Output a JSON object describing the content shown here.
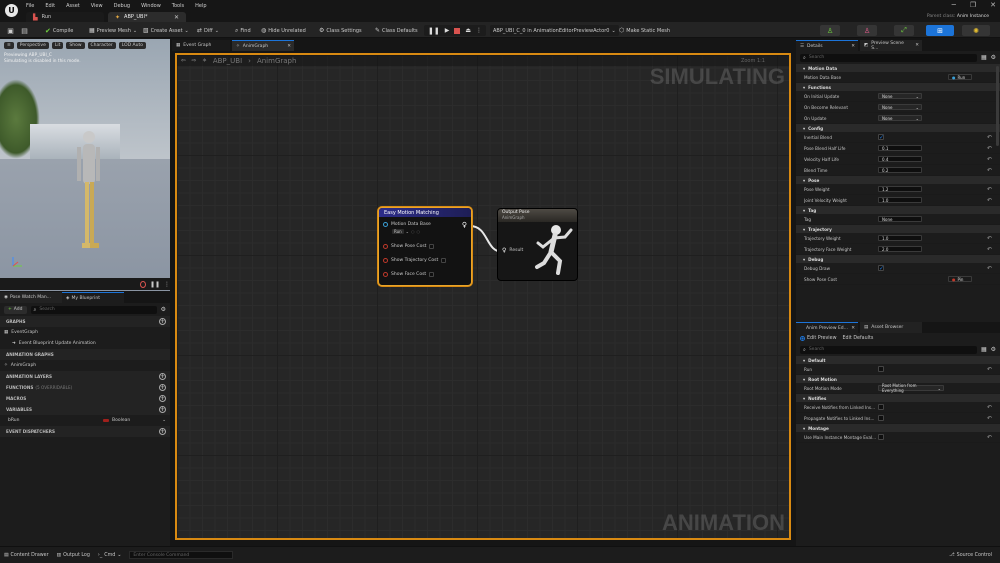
{
  "menu": [
    "File",
    "Edit",
    "Asset",
    "View",
    "Debug",
    "Window",
    "Tools",
    "Help"
  ],
  "tabs": [
    {
      "label": "Run"
    },
    {
      "label": "ABP_UBI*"
    }
  ],
  "parent_class": {
    "label": "Parent class:",
    "value": "Anim Instance"
  },
  "toolbar": {
    "compile": "Compile",
    "preview_mesh": "Preview Mesh",
    "create_asset": "Create Asset",
    "diff": "Diff",
    "find": "Find",
    "hide_unrelated": "Hide Unrelated",
    "class_settings": "Class Settings",
    "class_defaults": "Class Defaults",
    "debug_object": "ABP_UBI_C_0 in AnimationEditorPreviewActor0",
    "make_static_mesh": "Make Static Mesh"
  },
  "viewport": {
    "perspective": "Perspective",
    "lit": "Lit",
    "show": "Show",
    "character": "Character",
    "lod": "LOD Auto",
    "info1": "Previewing ABP_UBI_C",
    "info2": "Simulating is disabled in this mode."
  },
  "left_tabs": [
    "Pose Watch Man...",
    "My Blueprint"
  ],
  "my_blueprint": {
    "add": "Add",
    "search_placeholder": "Search",
    "graphs": "GRAPHS",
    "event_graph": "EventGraph",
    "event_update": "Event Blueprint Update Animation",
    "animation_graphs": "ANIMATION GRAPHS",
    "anim_graph": "AnimGraph",
    "animation_layers": "ANIMATION LAYERS",
    "functions": "FUNCTIONS",
    "functions_count": "(5 OVERRIDABLE)",
    "macros": "MACROS",
    "variables": "VARIABLES",
    "var_name": "bRun",
    "var_type": "Boolean",
    "event_dispatchers": "EVENT DISPATCHERS"
  },
  "graph_tabs": [
    "Event Graph",
    "AnimGraph"
  ],
  "breadcrumb": {
    "root": "ABP_UBI",
    "child": "AnimGraph",
    "zoom": "Zoom 1:1"
  },
  "graph": {
    "simulating": "SIMULATING",
    "animation": "ANIMATION"
  },
  "node_emm": {
    "title": "Easy Motion Matching",
    "motion_data": "Motion Data Base",
    "motion_val": "Run",
    "pins": [
      "Show Pose Cost",
      "Show Trajectory Cost",
      "Show Face Cost"
    ]
  },
  "node_out": {
    "title": "Output Pose",
    "subtitle": "AnimGraph",
    "result": "Result"
  },
  "details": {
    "tab": "Details",
    "tab2": "Preview Scene S...",
    "search_placeholder": "Search",
    "sections": [
      {
        "name": "Motion Data",
        "props": [
          {
            "label": "Motion Data Base",
            "type": "asset",
            "value": "Run"
          }
        ]
      },
      {
        "name": "Functions",
        "props": [
          {
            "label": "On Initial Update",
            "type": "dropdown",
            "value": "None"
          },
          {
            "label": "On Become Relevant",
            "type": "dropdown",
            "value": "None"
          },
          {
            "label": "On Update",
            "type": "dropdown",
            "value": "None"
          }
        ]
      },
      {
        "name": "Config",
        "props": [
          {
            "label": "Inertial Blend",
            "type": "check",
            "value": "true"
          },
          {
            "label": "Pose Blend Half Life",
            "type": "num",
            "value": "0.1"
          },
          {
            "label": "Velocity Half Life",
            "type": "num",
            "value": "0.4"
          },
          {
            "label": "Blend Time",
            "type": "num",
            "value": "0.2"
          }
        ]
      },
      {
        "name": "Pose",
        "props": [
          {
            "label": "Pose Weight",
            "type": "num",
            "value": "1.2"
          },
          {
            "label": "Joint Velocity Weight",
            "type": "num",
            "value": "1.0"
          }
        ]
      },
      {
        "name": "Tag",
        "props": [
          {
            "label": "Tag",
            "type": "text",
            "value": "None"
          }
        ]
      },
      {
        "name": "Trajectory",
        "props": [
          {
            "label": "Trajectory Weight",
            "type": "num",
            "value": "1.0"
          },
          {
            "label": "Trajectory Face Weight",
            "type": "num",
            "value": "2.0"
          }
        ]
      },
      {
        "name": "Debug",
        "props": [
          {
            "label": "Debug Draw",
            "type": "check",
            "value": "true"
          },
          {
            "label": "Show Pose Cost",
            "type": "asset",
            "value": "Pin"
          }
        ]
      }
    ]
  },
  "anim_preview": {
    "tab": "Anim Preview Ed...",
    "tab2": "Asset Browser",
    "edit_preview": "Edit Preview",
    "edit_defaults": "Edit Defaults",
    "search_placeholder": "Search",
    "sections": [
      {
        "name": "Default",
        "props": [
          {
            "label": "Run",
            "type": "check",
            "value": "false"
          }
        ]
      },
      {
        "name": "Root Motion",
        "props": [
          {
            "label": "Root Motion Mode",
            "type": "dropdown",
            "value": "Root Motion from Everything"
          }
        ]
      },
      {
        "name": "Notifies",
        "props": [
          {
            "label": "Receive Notifies from Linked Ins...",
            "type": "check",
            "value": "false"
          },
          {
            "label": "Propagate Notifies to Linked Ins...",
            "type": "check",
            "value": "false"
          }
        ]
      },
      {
        "name": "Montage",
        "props": [
          {
            "label": "Use Main Instance Montage Eval...",
            "type": "check",
            "value": "false"
          }
        ]
      }
    ]
  },
  "status": {
    "content_drawer": "Content Drawer",
    "output_log": "Output Log",
    "cmd": "Cmd",
    "console_placeholder": "Enter Console Command",
    "source_control": "Source Control"
  },
  "colors": {
    "accent": "#d98a12",
    "node_header": "#2d2d8a",
    "blue_button": "#1c74d9"
  }
}
